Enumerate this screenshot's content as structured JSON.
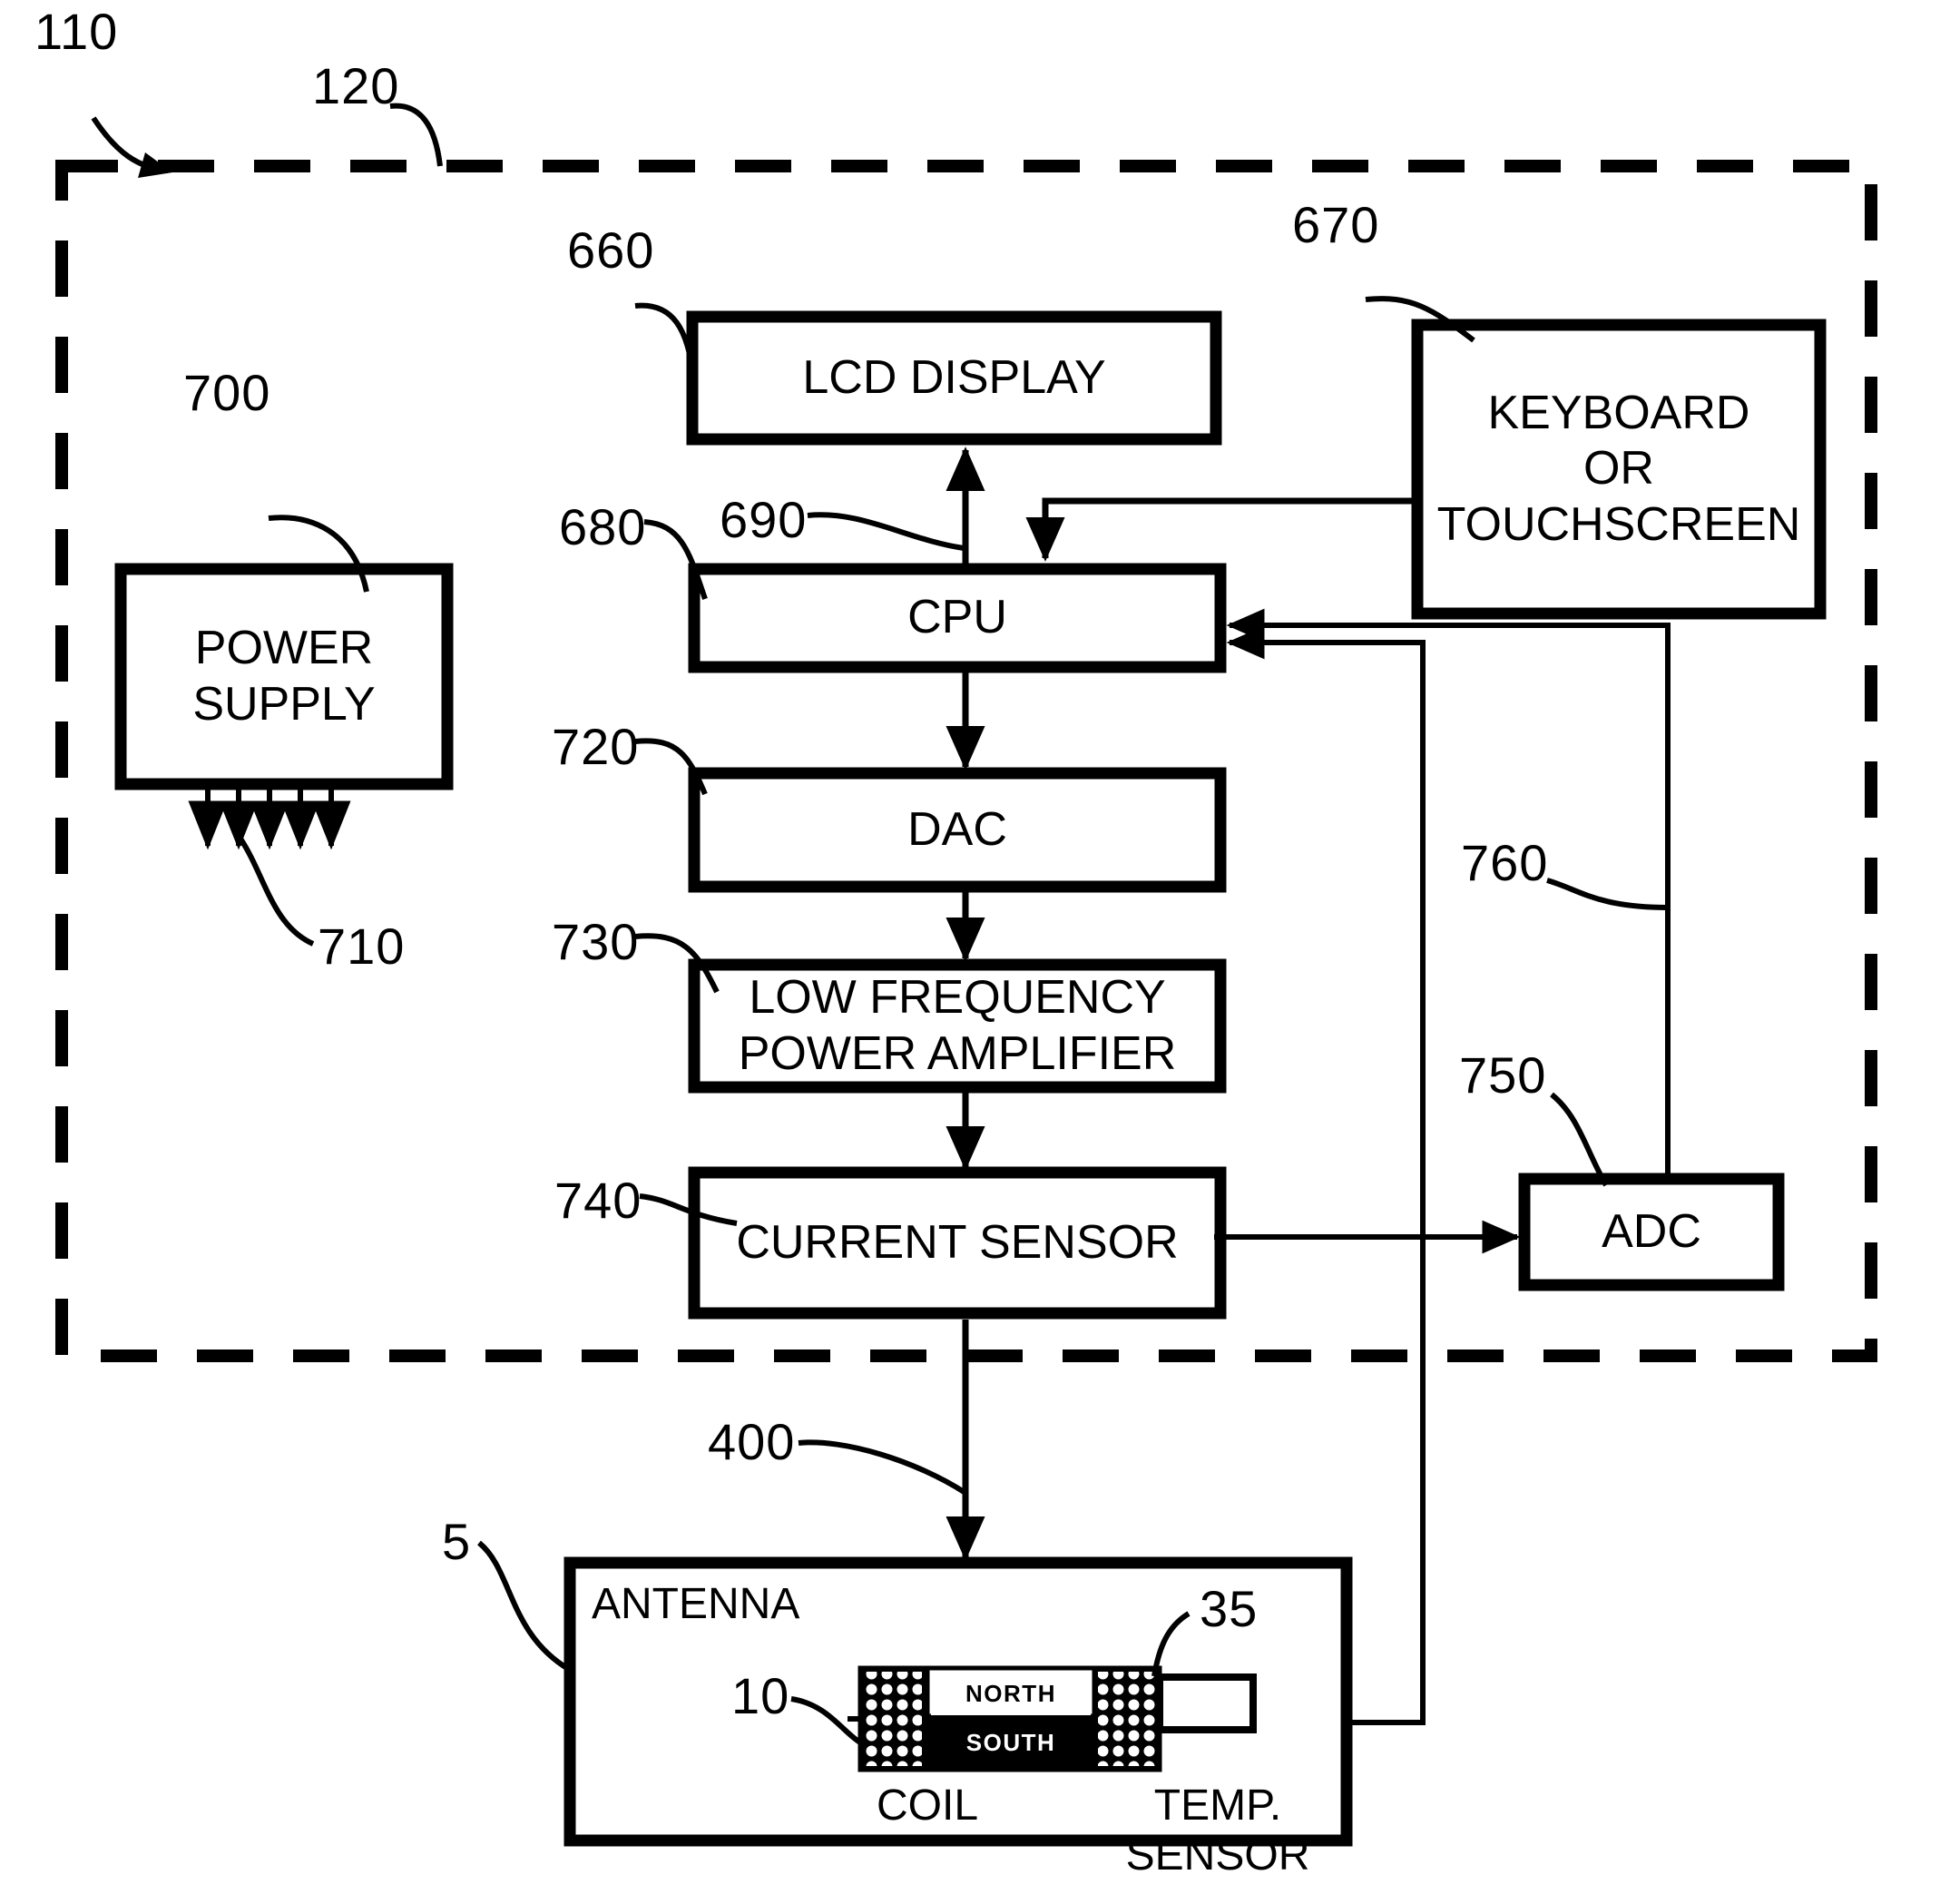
{
  "figure": {
    "type": "patent-block-diagram",
    "background": "#ffffff",
    "line_color": "#000000"
  },
  "enclosure": {
    "name": "dashed-enclosure",
    "style": "dashed",
    "ref_outer": "110",
    "ref_boundary": "120"
  },
  "blocks": [
    {
      "id": "lcd",
      "label": "LCD DISPLAY",
      "ref": "660"
    },
    {
      "id": "keyboard",
      "label": "KEYBOARD\nOR\nTOUCHSCREEN",
      "ref": "670"
    },
    {
      "id": "cpu",
      "label": "CPU",
      "ref": "680"
    },
    {
      "id": "dac",
      "label": "DAC",
      "ref": "720"
    },
    {
      "id": "lfpa",
      "label": "LOW FREQUENCY\nPOWER AMPLIFIER",
      "ref": "730"
    },
    {
      "id": "isense",
      "label": "CURRENT SENSOR",
      "ref": "740"
    },
    {
      "id": "psu",
      "label": "POWER\nSUPPLY",
      "ref": "700"
    },
    {
      "id": "adc",
      "label": "ADC",
      "ref": "750"
    },
    {
      "id": "antenna",
      "label": "ANTENNA",
      "ref": "400"
    }
  ],
  "connection_refs": {
    "cpu_to_lcd": "690",
    "psu_rails": "710",
    "adc_to_cpu": "760"
  },
  "antenna_detail": {
    "ref_box": "5",
    "coil_ref": "10",
    "coil_caption": "COIL",
    "magnet_north": "NORTH",
    "magnet_south": "SOUTH",
    "temp_sensor_ref": "35",
    "temp_sensor_caption": "TEMP.\nSENSOR"
  },
  "labels": {
    "r110": "110",
    "r120": "120",
    "r660": "660",
    "r670": "670",
    "r680": "680",
    "r690": "690",
    "r700": "700",
    "r710": "710",
    "r720": "720",
    "r730": "730",
    "r740": "740",
    "r750": "750",
    "r760": "760",
    "r400": "400",
    "r5": "5",
    "r10": "10",
    "r35": "35"
  },
  "texts": {
    "lcd_display": "LCD DISPLAY",
    "keyboard_or_touchscreen": "KEYBOARD\nOR\nTOUCHSCREEN",
    "cpu": "CPU",
    "dac": "DAC",
    "low_frequency_power_amplifier": "LOW FREQUENCY\nPOWER AMPLIFIER",
    "current_sensor": "CURRENT SENSOR",
    "power_supply": "POWER\nSUPPLY",
    "adc": "ADC",
    "antenna": "ANTENNA",
    "coil": "COIL",
    "north": "NORTH",
    "south": "SOUTH",
    "temp_sensor": "TEMP.\nSENSOR"
  }
}
